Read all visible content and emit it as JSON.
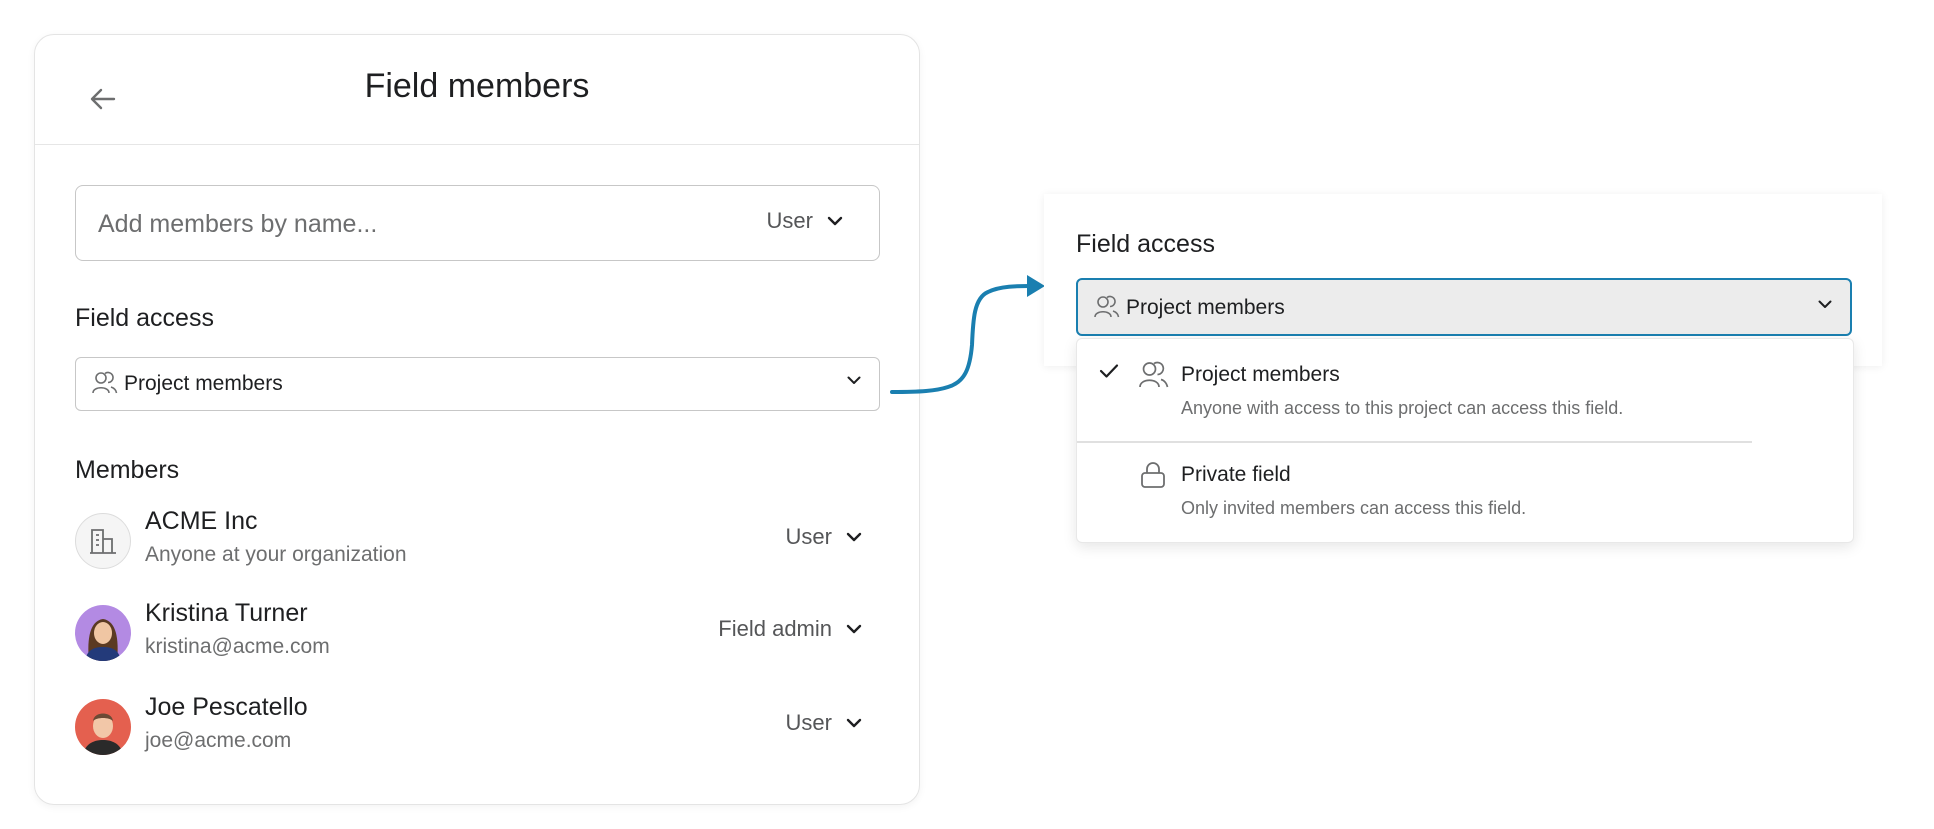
{
  "panel": {
    "title": "Field members",
    "search": {
      "placeholder": "Add members by name...",
      "value": "",
      "role": "User"
    },
    "field_access_label": "Field access",
    "field_access_value": "Project members",
    "members_label": "Members",
    "members": [
      {
        "name": "ACME Inc",
        "sub": "Anyone at your organization",
        "role": "User",
        "avatar": "building-icon"
      },
      {
        "name": "Kristina Turner",
        "sub": "kristina@acme.com",
        "role": "Field admin",
        "avatar": "photo",
        "avatar_color": "#b38ae3"
      },
      {
        "name": "Joe Pescatello",
        "sub": "joe@acme.com",
        "role": "User",
        "avatar": "photo",
        "avatar_color": "#e4604f"
      }
    ]
  },
  "zoom": {
    "field_access_label": "Field access",
    "selected_value": "Project members",
    "options": [
      {
        "title": "Project members",
        "description": "Anyone with access to this project can access this field.",
        "icon": "people-icon",
        "selected": true
      },
      {
        "title": "Private field",
        "description": "Only invited members can access this field.",
        "icon": "lock-icon",
        "selected": false
      }
    ]
  },
  "colors": {
    "focus_border": "#1a7fb0",
    "connector": "#1a7fb0"
  }
}
